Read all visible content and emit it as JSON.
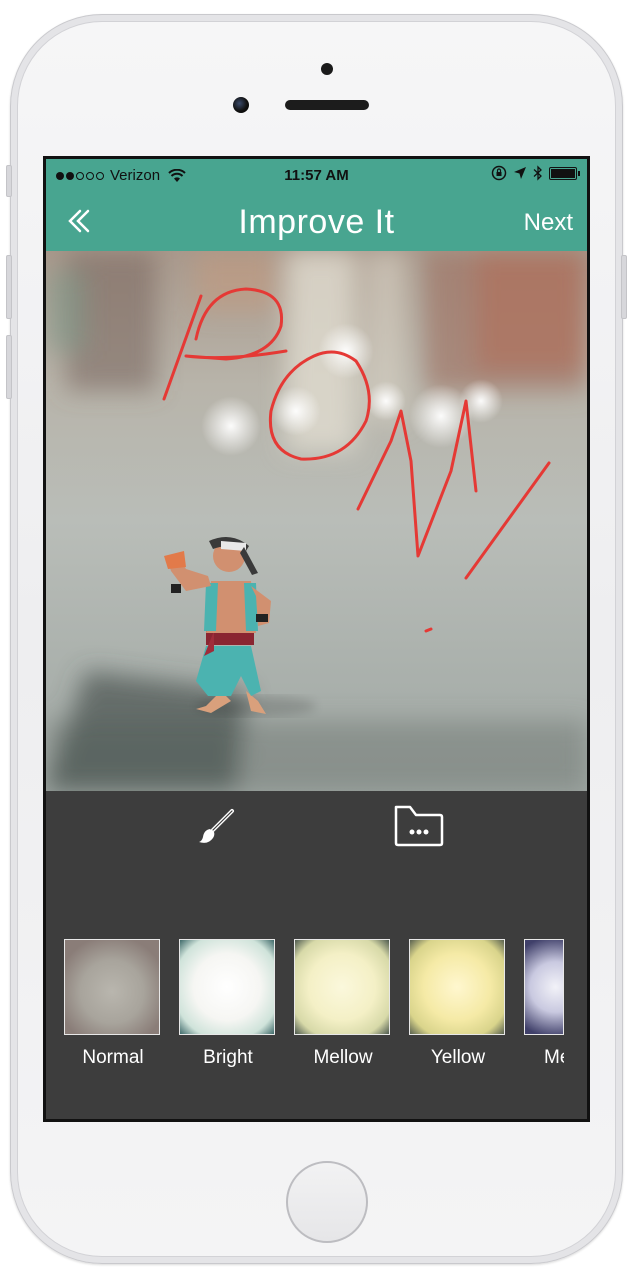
{
  "status_bar": {
    "carrier": "Verizon",
    "time": "11:57 AM",
    "signal_bars": 2,
    "signal_total": 5
  },
  "nav": {
    "title": "Improve It",
    "next_label": "Next",
    "back_icon": "chevron-left-icon"
  },
  "colors": {
    "accent": "#48a590",
    "toolbar_bg": "#3d3d3d",
    "drawing_stroke": "#e53935"
  },
  "tools": {
    "brush_icon": "brush-icon",
    "folder_icon": "folder-more-icon"
  },
  "filters": [
    {
      "label": "Normal"
    },
    {
      "label": "Bright"
    },
    {
      "label": "Mellow"
    },
    {
      "label": "Yellow"
    },
    {
      "label": "Me"
    }
  ]
}
